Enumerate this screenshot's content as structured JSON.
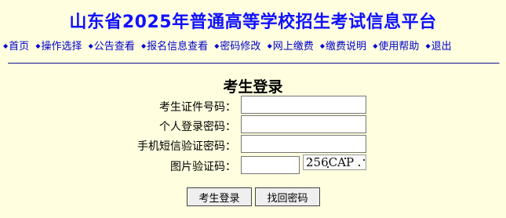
{
  "site": {
    "title": "山东省2025年普通高等学校招生考试信息平台"
  },
  "nav": {
    "items": [
      {
        "label": "首页"
      },
      {
        "label": "操作选择"
      },
      {
        "label": "公告查看"
      },
      {
        "label": "报名信息查看"
      },
      {
        "label": "密码修改"
      },
      {
        "label": "网上缴费"
      },
      {
        "label": "缴费说明"
      },
      {
        "label": "使用帮助"
      },
      {
        "label": "退出"
      }
    ],
    "bullet": "◆"
  },
  "login": {
    "heading": "考生登录",
    "fields": {
      "id_number": {
        "label": "考生证件号码：",
        "value": ""
      },
      "password": {
        "label": "个人登录密码：",
        "value": ""
      },
      "sms_code": {
        "label": "手机短信验证密码：",
        "value": ""
      },
      "captcha": {
        "label": "图片验证码：",
        "value": ""
      }
    },
    "captcha_image_text": "256CAP",
    "buttons": {
      "login": "考生登录",
      "recover": "找回密码"
    }
  },
  "colors": {
    "background": "#ffffe0",
    "title": "#1010ff",
    "nav_link": "#0000cc",
    "divider": "#1a1a8c"
  }
}
